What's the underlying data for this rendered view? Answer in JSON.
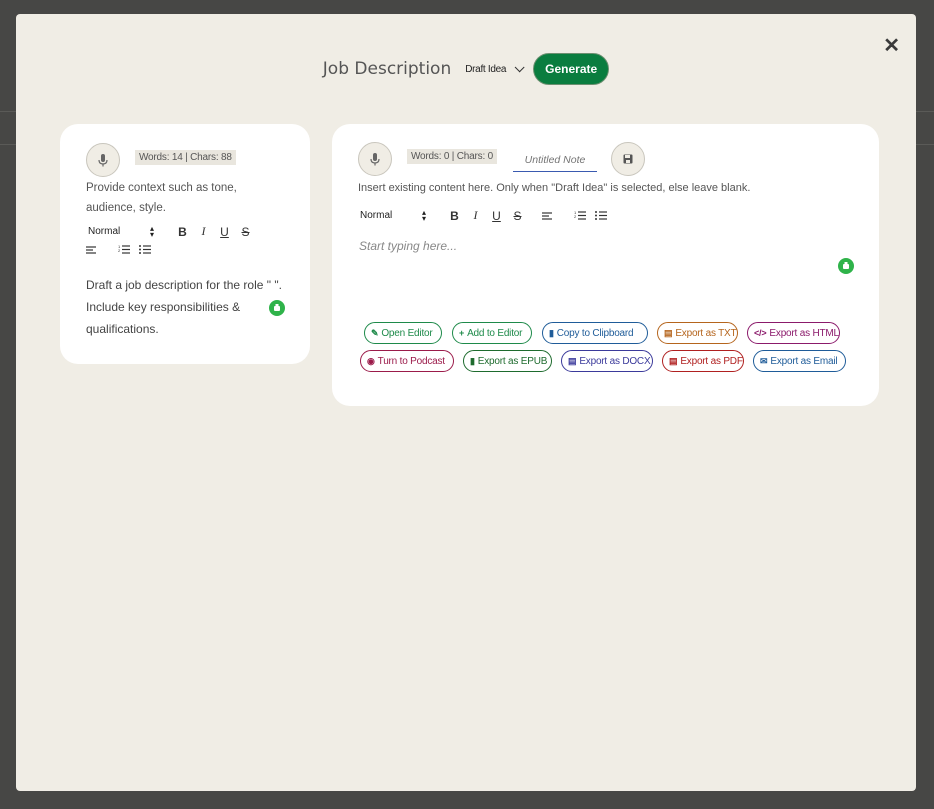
{
  "modal": {
    "title": "Job Description",
    "mode_select": "Draft Idea",
    "generate_label": "Generate",
    "close_glyph": "✕"
  },
  "left": {
    "counter": "Words: 14 | Chars: 88",
    "hint_line1": "Provide context such as tone,",
    "hint_line2": "audience, style.",
    "format": "Normal",
    "content_line1": "Draft a job description for the role \" \".",
    "content_line2": "Include key responsibilities &",
    "content_line3": "qualifications."
  },
  "right": {
    "counter": "Words: 0 | Chars: 0",
    "note_placeholder": "Untitled Note",
    "hint": "Insert existing content here. Only when \"Draft Idea\" is selected, else leave blank.",
    "format": "Normal",
    "editor_placeholder": "Start typing here..."
  },
  "actions": [
    {
      "label": "Open Editor",
      "color": "#1e8a4a",
      "icon": "pencil-icon"
    },
    {
      "label": "Add to Editor",
      "color": "#1e8a4a",
      "icon": "plus-icon"
    },
    {
      "label": "Copy to Clipboard",
      "color": "#1f5c99",
      "icon": "clipboard-icon"
    },
    {
      "label": "Export as TXT",
      "color": "#b5651d",
      "icon": "file-text-icon"
    },
    {
      "label": "Export as HTML",
      "color": "#8b1a6b",
      "icon": "code-icon"
    },
    {
      "label": "Turn to Podcast",
      "color": "#9b1b4a",
      "icon": "podcast-icon"
    },
    {
      "label": "Export as EPUB",
      "color": "#1e6b2e",
      "icon": "book-icon"
    },
    {
      "label": "Export as DOCX",
      "color": "#3b3a9b",
      "icon": "file-word-icon"
    },
    {
      "label": "Export as PDF",
      "color": "#b02020",
      "icon": "file-pdf-icon"
    },
    {
      "label": "Export as Email",
      "color": "#1f5c99",
      "icon": "envelope-icon"
    }
  ]
}
